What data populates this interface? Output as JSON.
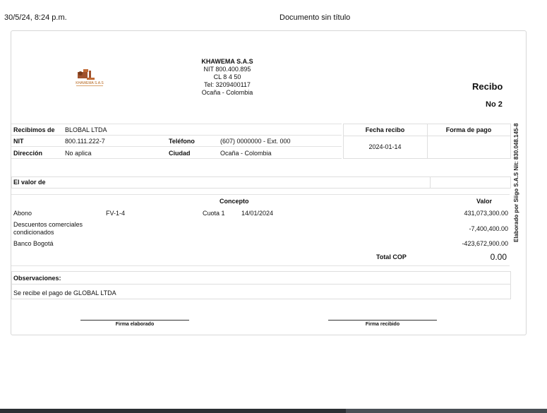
{
  "browser_header": {
    "datetime": "30/5/24, 8:24 p.m.",
    "doc_title": "Documento sin título"
  },
  "company": {
    "name": "KHAWEMA S.A.S",
    "nit": "NIT 800.400.895",
    "address": "CL 8 4 50",
    "phone": "Tel: 3209400117",
    "city": "Ocaña - Colombia",
    "logo_text": "KHAWEMA S.A.S"
  },
  "receipt": {
    "title": "Recibo",
    "number": "No 2"
  },
  "client": {
    "received_from_label": "Recibimos de",
    "received_from": "BLOBAL LTDA",
    "nit_label": "NIT",
    "nit": "800.111.222-7",
    "phone_label": "Teléfono",
    "phone": "(607) 0000000 - Ext. 000",
    "address_label": "Dirección",
    "address": "No aplica",
    "city_label": "Ciudad",
    "city": "Ocaña - Colombia"
  },
  "receipt_info": {
    "date_label": "Fecha recibo",
    "date": "2024-01-14",
    "payment_label": "Forma de pago",
    "payment": ""
  },
  "amount": {
    "label": "El valor de",
    "value": ""
  },
  "concepts": {
    "concept_header": "Concepto",
    "value_header": "Valor",
    "rows": [
      {
        "name": "Abono",
        "ref": "FV-1-4",
        "detail": "Cuota 1",
        "date": "14/01/2024",
        "value": "431,073,300.00"
      },
      {
        "name": "Descuentos comerciales condicionados",
        "ref": "",
        "detail": "",
        "date": "",
        "value": "-7,400,400.00"
      },
      {
        "name": "Banco Bogotá",
        "ref": "",
        "detail": "",
        "date": "",
        "value": "-423,672,900.00"
      }
    ],
    "total_label": "Total COP",
    "total_value": "0.00"
  },
  "observations": {
    "label": "Observaciones:",
    "text": "Se recibe el pago de GLOBAL LTDA"
  },
  "signatures": {
    "left": "Firma elaborado",
    "right": "Firma recibido"
  },
  "vertical_note": "Elaborado por Siigo S.A.S Nit: 830.048.145-8"
}
